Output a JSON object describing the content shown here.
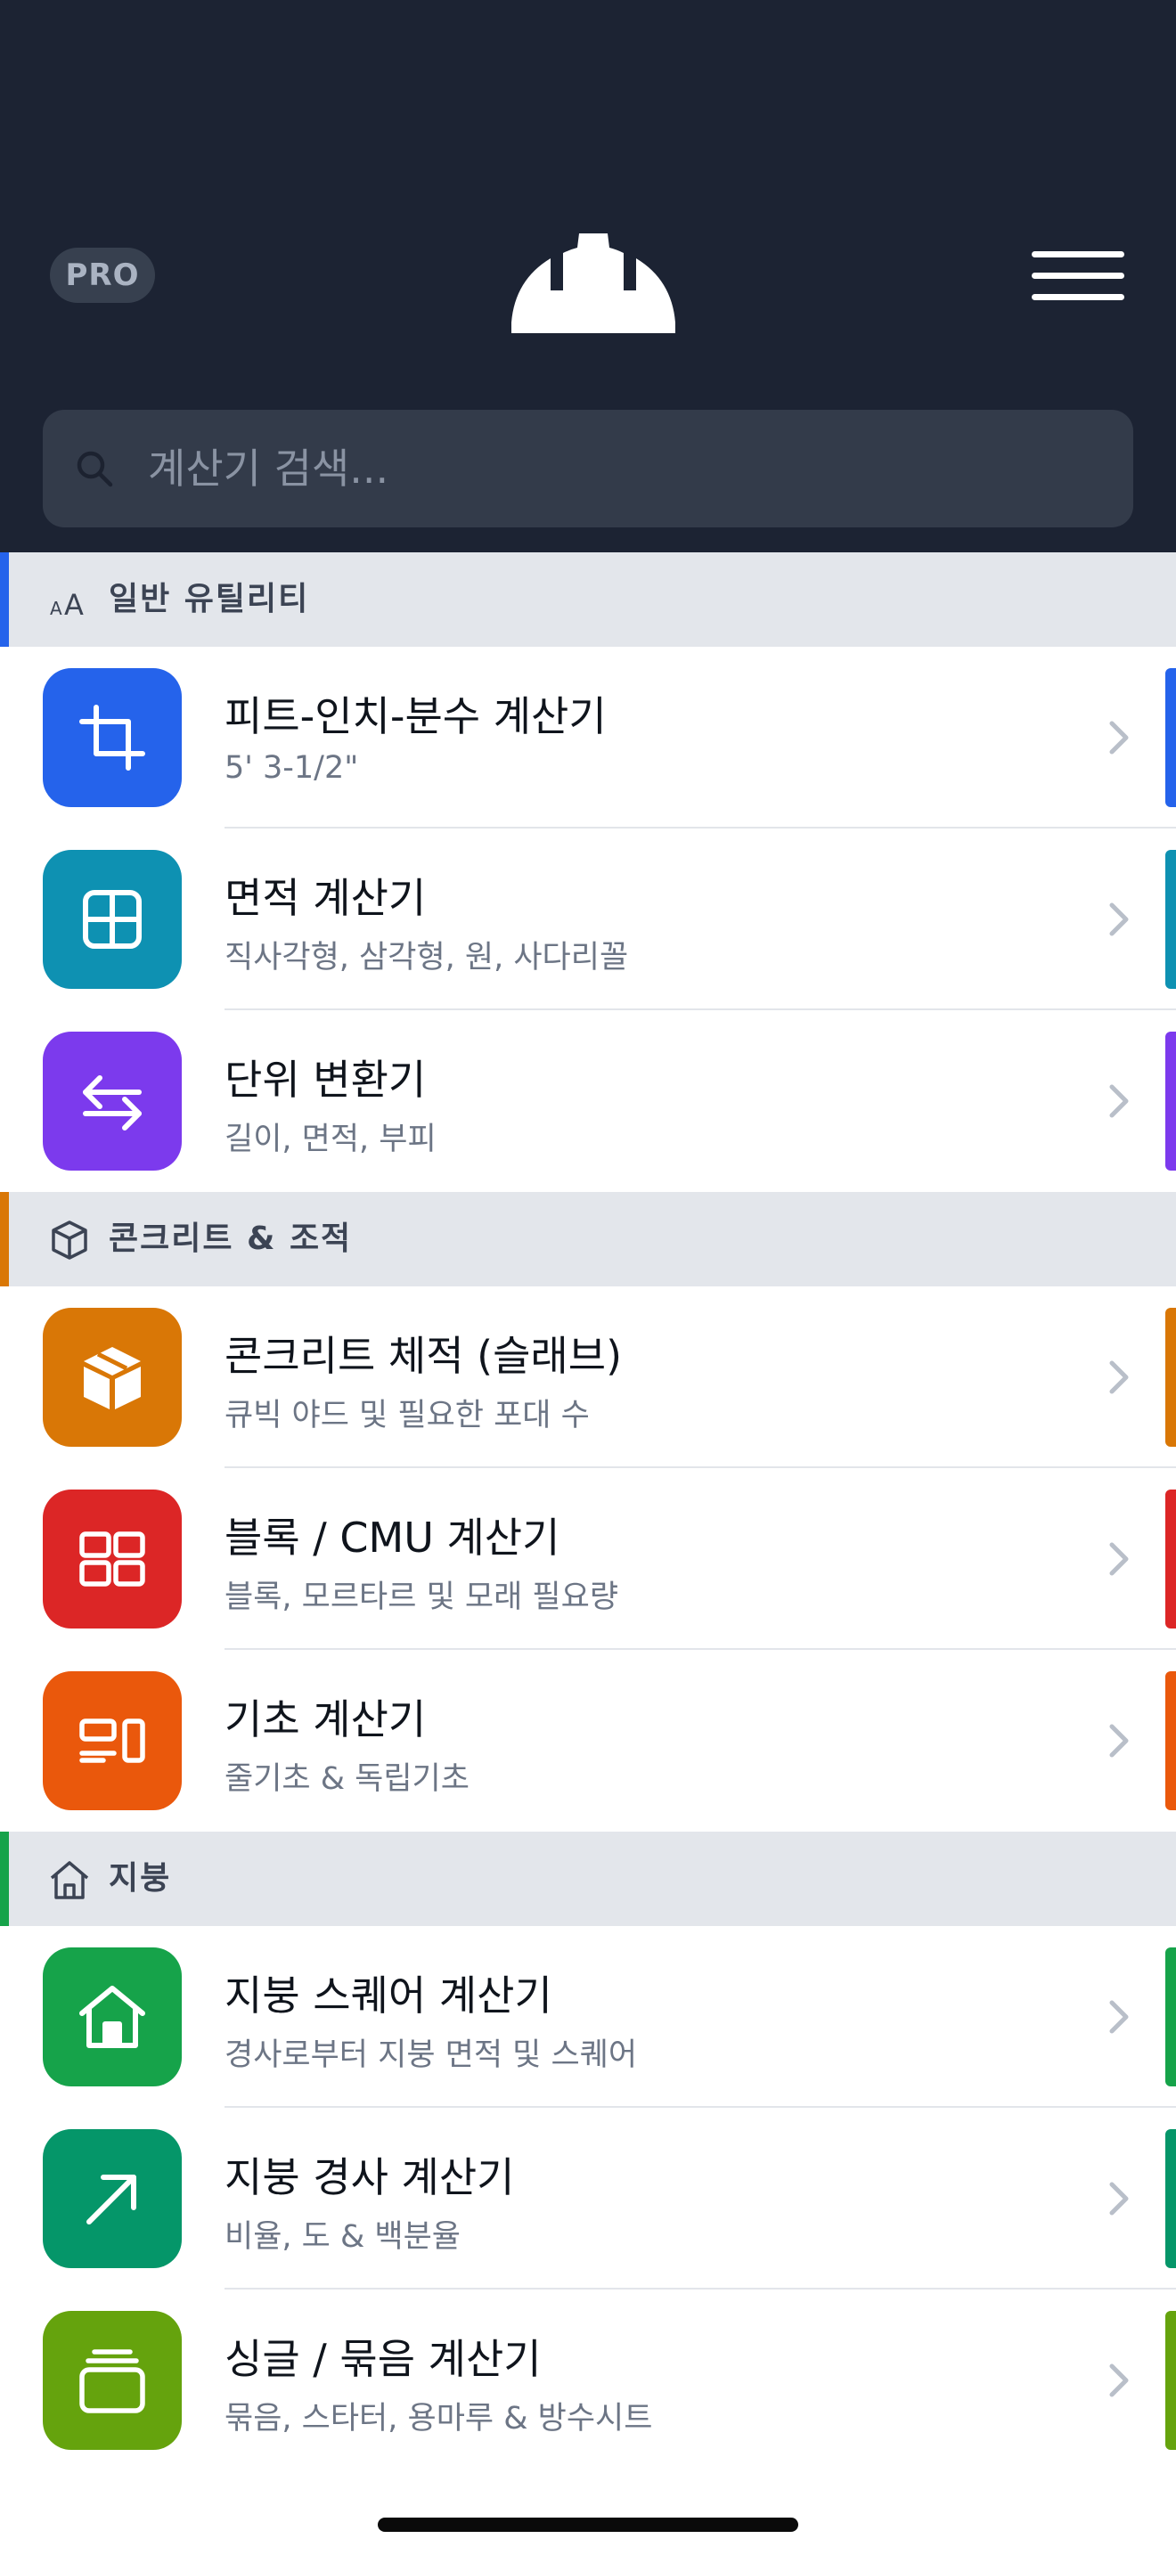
{
  "header": {
    "pro_badge": "PRO",
    "logo_icon": "hard-hat-icon",
    "menu_icon": "hamburger-menu-icon"
  },
  "search": {
    "placeholder": "계산기 검색...",
    "icon": "search-icon"
  },
  "sections": [
    {
      "title": "일반 유틸리티",
      "icon": "text-size-icon",
      "accent": "#2563eb",
      "items": [
        {
          "title": "피트-인치-분수 계산기",
          "subtitle": "5' 3-1/2\"",
          "icon": "crop-icon",
          "color": "#2563eb"
        },
        {
          "title": "면적 계산기",
          "subtitle": "직사각형, 삼각형, 원, 사다리꼴",
          "icon": "grid-square-icon",
          "color": "#0e91b2"
        },
        {
          "title": "단위 변환기",
          "subtitle": "길이, 면적, 부피",
          "icon": "swap-arrows-icon",
          "color": "#7c3aed"
        }
      ]
    },
    {
      "title": "콘크리트 & 조적",
      "icon": "cube-outline-icon",
      "accent": "#d97706",
      "items": [
        {
          "title": "콘크리트 체적 (슬래브)",
          "subtitle": "큐빅 야드 및 필요한 포대 수",
          "icon": "box-icon",
          "color": "#d97706"
        },
        {
          "title": "블록 / CMU 계산기",
          "subtitle": "블록, 모르타르 및 모래 필요량",
          "icon": "blocks-icon",
          "color": "#dc2626"
        },
        {
          "title": "기초 계산기",
          "subtitle": "줄기초 & 독립기초",
          "icon": "footing-icon",
          "color": "#ea580c"
        }
      ]
    },
    {
      "title": "지붕",
      "icon": "house-outline-icon",
      "accent": "#16a34a",
      "items": [
        {
          "title": "지붕 스퀘어 계산기",
          "subtitle": "경사로부터 지붕 면적 및 스퀘어",
          "icon": "house-icon",
          "color": "#16a34a"
        },
        {
          "title": "지붕 경사 계산기",
          "subtitle": "비율, 도 & 백분율",
          "icon": "arrow-up-right-icon",
          "color": "#059669"
        },
        {
          "title": "싱글 / 묶음 계산기",
          "subtitle": "묶음, 스타터, 용마루 & 방수시트",
          "icon": "layers-icon",
          "color": "#65a30d"
        }
      ]
    }
  ]
}
